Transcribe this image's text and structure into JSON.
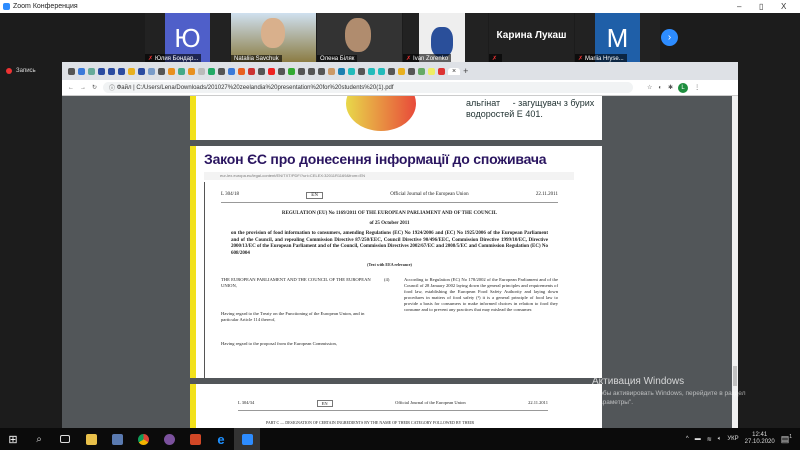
{
  "window": {
    "title": "Zoom Конференция",
    "min": "–",
    "max": "▯",
    "close": "X"
  },
  "participants": [
    {
      "name": "Юлия Бондар...",
      "avatar": "Ю",
      "color": "#4f5fc9",
      "muted": true
    },
    {
      "name": "Nataliia Savchuk",
      "video": true,
      "muted": false
    },
    {
      "name": "Олена Біляк",
      "video": true,
      "muted": false
    },
    {
      "name": "Ivan Zorenko",
      "video": true,
      "muted": true
    },
    {
      "name": "Карина Лукаш",
      "muted": true
    },
    {
      "name": "Mariia Hryse...",
      "avatar": "M",
      "color": "#1f5fa8",
      "muted": true
    }
  ],
  "recording": "Запись",
  "browser": {
    "new_tab": "+",
    "close_tab": "×",
    "address_label": "Файл",
    "url": "C:/Users/Lena/Downloads/201027%20zeelandia%20presentation%20for%20students%20(1).pdf",
    "profile_initial": "L"
  },
  "slide1": {
    "line1": "альгінат     - загущувач з бурих",
    "line2": "водоростей Е 401."
  },
  "slide2": {
    "title": "Закон ЄС про донесення інформації до споживача",
    "inner_url": "eur-lex.europa.eu/legal-content/EN/TXT/PDF/?uri=CELEX:32011R1169&from=EN",
    "header_ref": "L 304/18",
    "header_lang": "EN",
    "header_journal": "Official Journal of the European Union",
    "header_date": "22.11.2011",
    "reg_title": "REGULATION (EU) No 1169/2011 OF THE EUROPEAN PARLIAMENT AND OF THE COUNCIL",
    "reg_date": "of 25 October 2011",
    "reg_sub": "on the provision of food information to consumers, amending Regulations (EC) No 1924/2006 and (EC) No 1925/2006 of the European Parliament and of the Council, and repealing Commission Directive 87/250/EEC, Council Directive 90/496/EEC, Commission Directive 1999/10/EC, Directive 2000/13/EC of the European Parliament and of the Council, Commission Directives 2002/67/EC and 2008/5/EC and Commission Regulation (EC) No 608/2004",
    "eea": "(Text with EEA relevance)",
    "left1": "THE EUROPEAN PARLIAMENT AND THE COUNCIL OF THE EUROPEAN UNION,",
    "left2": "Having regard to the Treaty on the Functioning of the European Union, and in particular Article 114 thereof,",
    "left3": "Having regard to the proposal from the European Commission,",
    "num": "(4)",
    "right1": "According to Regulation (EC) No 178/2002 of the European Parliament and of the Council of 28 January 2002 laying down the general principles and requirements of food law, establishing the European Food Safety Authority and laying down procedures in matters of food safety (¹) it is a general principle of food law to provide a basis for consumers to make informed choices in relation to food they consume and to prevent any practices that may mislead the consumer."
  },
  "slide3": {
    "header_ref": "L 304/34",
    "header_lang": "EN",
    "header_journal": "Official Journal of the European Union",
    "header_date": "22.11.2011",
    "part": "PART C — DESIGNATION OF CERTAIN INGREDIENTS BY THE NAME OF THEIR CATEGORY FOLLOWED BY THEIR"
  },
  "watermark": {
    "title": "Активация Windows",
    "line1": "Чтобы активировать Windows, перейдите в раздел",
    "line2": "\"Параметры\"."
  },
  "taskbar": {
    "lang": "УКР",
    "time": "12:41",
    "date": "27.10.2020",
    "notif": "1"
  }
}
